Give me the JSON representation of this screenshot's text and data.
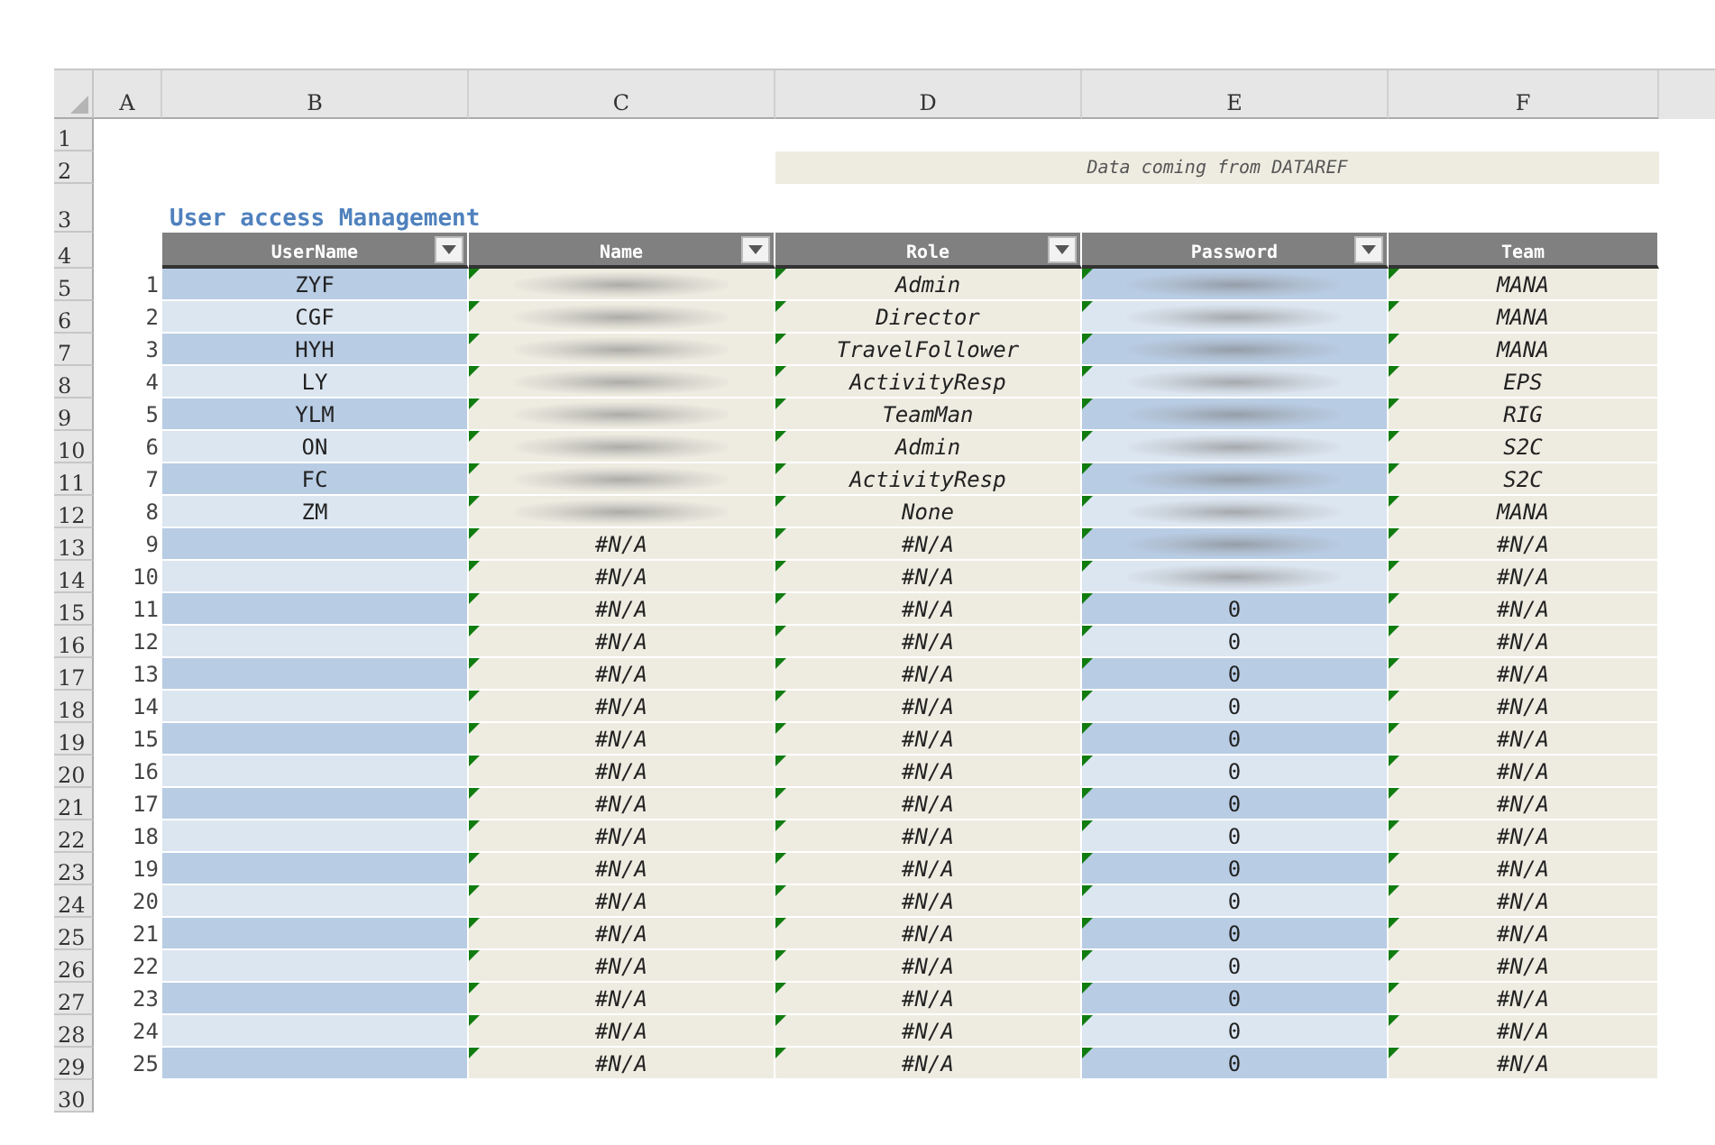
{
  "column_headers": [
    "A",
    "B",
    "C",
    "D",
    "E",
    "F"
  ],
  "row_numbers": [
    "1",
    "2",
    "3",
    "4",
    "5",
    "6",
    "7",
    "8",
    "9",
    "10",
    "11",
    "12",
    "13",
    "14",
    "15",
    "16",
    "17",
    "18",
    "19",
    "20",
    "21",
    "22",
    "23",
    "24",
    "25",
    "26",
    "27",
    "28",
    "29",
    "30"
  ],
  "banner": "Data coming from DATAREF",
  "title": "User access Management",
  "table": {
    "columns": [
      {
        "label": "UserName",
        "filter": true,
        "kind": "banded"
      },
      {
        "label": "Name",
        "filter": true,
        "flagged": true,
        "kind": "plain"
      },
      {
        "label": "Role",
        "filter": true,
        "flagged": true,
        "kind": "plain"
      },
      {
        "label": "Password",
        "filter": true,
        "flagged": true,
        "kind": "banded"
      },
      {
        "label": "Team",
        "filter": false,
        "flagged": true,
        "kind": "plain"
      }
    ],
    "rows": [
      {
        "index": "1",
        "cells": [
          {
            "text": "ZYF"
          },
          {
            "blurred": true
          },
          {
            "text": "Admin"
          },
          {
            "blurred": true
          },
          {
            "text": "MANA"
          }
        ]
      },
      {
        "index": "2",
        "cells": [
          {
            "text": "CGF"
          },
          {
            "blurred": true
          },
          {
            "text": "Director"
          },
          {
            "blurred": true
          },
          {
            "text": "MANA"
          }
        ]
      },
      {
        "index": "3",
        "cells": [
          {
            "text": "HYH"
          },
          {
            "blurred": true
          },
          {
            "text": "TravelFollower"
          },
          {
            "blurred": true
          },
          {
            "text": "MANA"
          }
        ]
      },
      {
        "index": "4",
        "cells": [
          {
            "text": "LY"
          },
          {
            "blurred": true
          },
          {
            "text": "ActivityResp"
          },
          {
            "blurred": true
          },
          {
            "text": "EPS"
          }
        ]
      },
      {
        "index": "5",
        "cells": [
          {
            "text": "YLM"
          },
          {
            "blurred": true
          },
          {
            "text": "TeamMan"
          },
          {
            "blurred": true
          },
          {
            "text": "RIG"
          }
        ]
      },
      {
        "index": "6",
        "cells": [
          {
            "text": "ON"
          },
          {
            "blurred": true
          },
          {
            "text": "Admin"
          },
          {
            "blurred": true
          },
          {
            "text": "S2C"
          }
        ]
      },
      {
        "index": "7",
        "cells": [
          {
            "text": "FC"
          },
          {
            "blurred": true
          },
          {
            "text": "ActivityResp"
          },
          {
            "blurred": true
          },
          {
            "text": "S2C"
          }
        ]
      },
      {
        "index": "8",
        "cells": [
          {
            "text": "ZM"
          },
          {
            "blurred": true
          },
          {
            "text": "None"
          },
          {
            "blurred": true
          },
          {
            "text": "MANA"
          }
        ]
      },
      {
        "index": "9",
        "cells": [
          {},
          {
            "text": "#N/A"
          },
          {
            "text": "#N/A"
          },
          {
            "blurred": true
          },
          {
            "text": "#N/A"
          }
        ]
      },
      {
        "index": "10",
        "cells": [
          {},
          {
            "text": "#N/A"
          },
          {
            "text": "#N/A"
          },
          {
            "blurred": true
          },
          {
            "text": "#N/A"
          }
        ]
      },
      {
        "index": "11",
        "cells": [
          {},
          {
            "text": "#N/A"
          },
          {
            "text": "#N/A"
          },
          {
            "text": "0"
          },
          {
            "text": "#N/A"
          }
        ]
      },
      {
        "index": "12",
        "cells": [
          {},
          {
            "text": "#N/A"
          },
          {
            "text": "#N/A"
          },
          {
            "text": "0"
          },
          {
            "text": "#N/A"
          }
        ]
      },
      {
        "index": "13",
        "cells": [
          {},
          {
            "text": "#N/A"
          },
          {
            "text": "#N/A"
          },
          {
            "text": "0"
          },
          {
            "text": "#N/A"
          }
        ]
      },
      {
        "index": "14",
        "cells": [
          {},
          {
            "text": "#N/A"
          },
          {
            "text": "#N/A"
          },
          {
            "text": "0"
          },
          {
            "text": "#N/A"
          }
        ]
      },
      {
        "index": "15",
        "cells": [
          {},
          {
            "text": "#N/A"
          },
          {
            "text": "#N/A"
          },
          {
            "text": "0"
          },
          {
            "text": "#N/A"
          }
        ]
      },
      {
        "index": "16",
        "cells": [
          {},
          {
            "text": "#N/A"
          },
          {
            "text": "#N/A"
          },
          {
            "text": "0"
          },
          {
            "text": "#N/A"
          }
        ]
      },
      {
        "index": "17",
        "cells": [
          {},
          {
            "text": "#N/A"
          },
          {
            "text": "#N/A"
          },
          {
            "text": "0"
          },
          {
            "text": "#N/A"
          }
        ]
      },
      {
        "index": "18",
        "cells": [
          {},
          {
            "text": "#N/A"
          },
          {
            "text": "#N/A"
          },
          {
            "text": "0"
          },
          {
            "text": "#N/A"
          }
        ]
      },
      {
        "index": "19",
        "cells": [
          {},
          {
            "text": "#N/A"
          },
          {
            "text": "#N/A"
          },
          {
            "text": "0"
          },
          {
            "text": "#N/A"
          }
        ]
      },
      {
        "index": "20",
        "cells": [
          {},
          {
            "text": "#N/A"
          },
          {
            "text": "#N/A"
          },
          {
            "text": "0"
          },
          {
            "text": "#N/A"
          }
        ]
      },
      {
        "index": "21",
        "cells": [
          {},
          {
            "text": "#N/A"
          },
          {
            "text": "#N/A"
          },
          {
            "text": "0"
          },
          {
            "text": "#N/A"
          }
        ]
      },
      {
        "index": "22",
        "cells": [
          {},
          {
            "text": "#N/A"
          },
          {
            "text": "#N/A"
          },
          {
            "text": "0"
          },
          {
            "text": "#N/A"
          }
        ]
      },
      {
        "index": "23",
        "cells": [
          {},
          {
            "text": "#N/A"
          },
          {
            "text": "#N/A"
          },
          {
            "text": "0"
          },
          {
            "text": "#N/A"
          }
        ]
      },
      {
        "index": "24",
        "cells": [
          {},
          {
            "text": "#N/A"
          },
          {
            "text": "#N/A"
          },
          {
            "text": "0"
          },
          {
            "text": "#N/A"
          }
        ]
      },
      {
        "index": "25",
        "cells": [
          {},
          {
            "text": "#N/A"
          },
          {
            "text": "#N/A"
          },
          {
            "text": "0"
          },
          {
            "text": "#N/A"
          }
        ]
      }
    ]
  }
}
